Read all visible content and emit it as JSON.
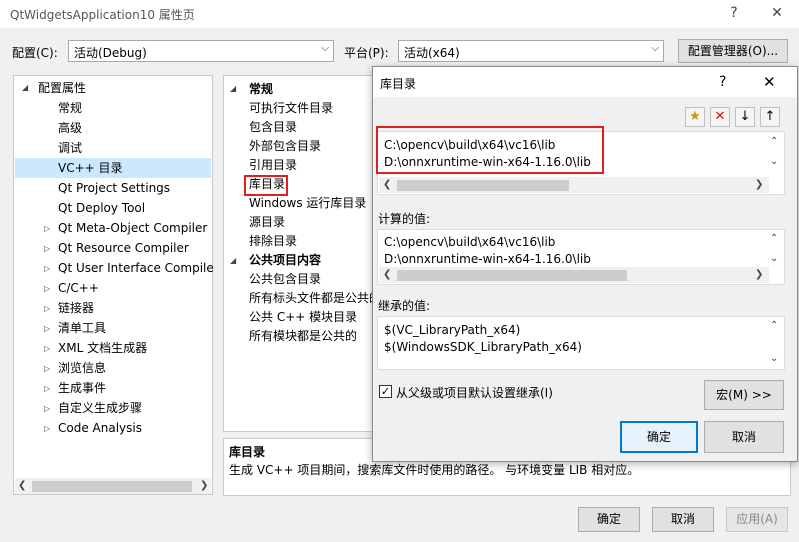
{
  "window": {
    "title": "QtWidgetsApplication10 属性页",
    "help_glyph": "?",
    "close_glyph": "✕"
  },
  "config_bar": {
    "config_label": "配置(C):",
    "config_value": "活动(Debug)",
    "platform_label": "平台(P):",
    "platform_value": "活动(x64)",
    "manager_button": "配置管理器(O)..."
  },
  "tree": {
    "root": "配置属性",
    "items": [
      {
        "label": "常规",
        "expandable": false
      },
      {
        "label": "高级",
        "expandable": false
      },
      {
        "label": "调试",
        "expandable": false
      },
      {
        "label": "VC++ 目录",
        "expandable": false,
        "selected": true
      },
      {
        "label": "Qt Project Settings",
        "expandable": false
      },
      {
        "label": "Qt Deploy Tool",
        "expandable": false
      },
      {
        "label": "Qt Meta-Object Compiler",
        "expandable": true
      },
      {
        "label": "Qt Resource Compiler",
        "expandable": true
      },
      {
        "label": "Qt User Interface Compile",
        "expandable": true
      },
      {
        "label": "C/C++",
        "expandable": true
      },
      {
        "label": "链接器",
        "expandable": true
      },
      {
        "label": "清单工具",
        "expandable": true
      },
      {
        "label": "XML 文档生成器",
        "expandable": true
      },
      {
        "label": "浏览信息",
        "expandable": true
      },
      {
        "label": "生成事件",
        "expandable": true
      },
      {
        "label": "自定义生成步骤",
        "expandable": true
      },
      {
        "label": "Code Analysis",
        "expandable": true
      }
    ]
  },
  "props": {
    "group1": "常规",
    "group1_items": [
      "可执行文件目录",
      "包含目录",
      "外部包含目录",
      "引用目录",
      "库目录",
      "Windows 运行库目录",
      "源目录",
      "排除目录"
    ],
    "group2": "公共项目内容",
    "group2_items": [
      "公共包含目录",
      "所有标头文件都是公共的",
      "公共 C++ 模块目录",
      "所有模块都是公共的"
    ],
    "desc_title": "库目录",
    "desc_text": "生成 VC++ 项目期间，搜索库文件时使用的路径。 与环境变量 LIB 相对应。"
  },
  "footer": {
    "ok": "确定",
    "cancel": "取消",
    "apply": "应用(A)"
  },
  "dialog": {
    "title": "库目录",
    "help_glyph": "?",
    "close_glyph": "✕",
    "toolbar_icons": [
      "new-line-icon",
      "delete-icon",
      "move-down-icon",
      "move-up-icon"
    ],
    "entries": [
      "C:\\opencv\\build\\x64\\vc16\\lib",
      "D:\\onnxruntime-win-x64-1.16.0\\lib"
    ],
    "computed_label": "计算的值:",
    "computed": [
      "C:\\opencv\\build\\x64\\vc16\\lib",
      "D:\\onnxruntime-win-x64-1.16.0\\lib"
    ],
    "inherited_label": "继承的值:",
    "inherited": [
      "$(VC_LibraryPath_x64)",
      "$(WindowsSDK_LibraryPath_x64)"
    ],
    "inherit_checkbox": "从父级或项目默认设置继承(I)",
    "inherit_checked": true,
    "macro_button": "宏(M) >>",
    "ok": "确定",
    "cancel": "取消"
  },
  "colors": {
    "selection": "#cce8ff",
    "accent": "#0078d7",
    "highlight_box": "#e02020"
  }
}
